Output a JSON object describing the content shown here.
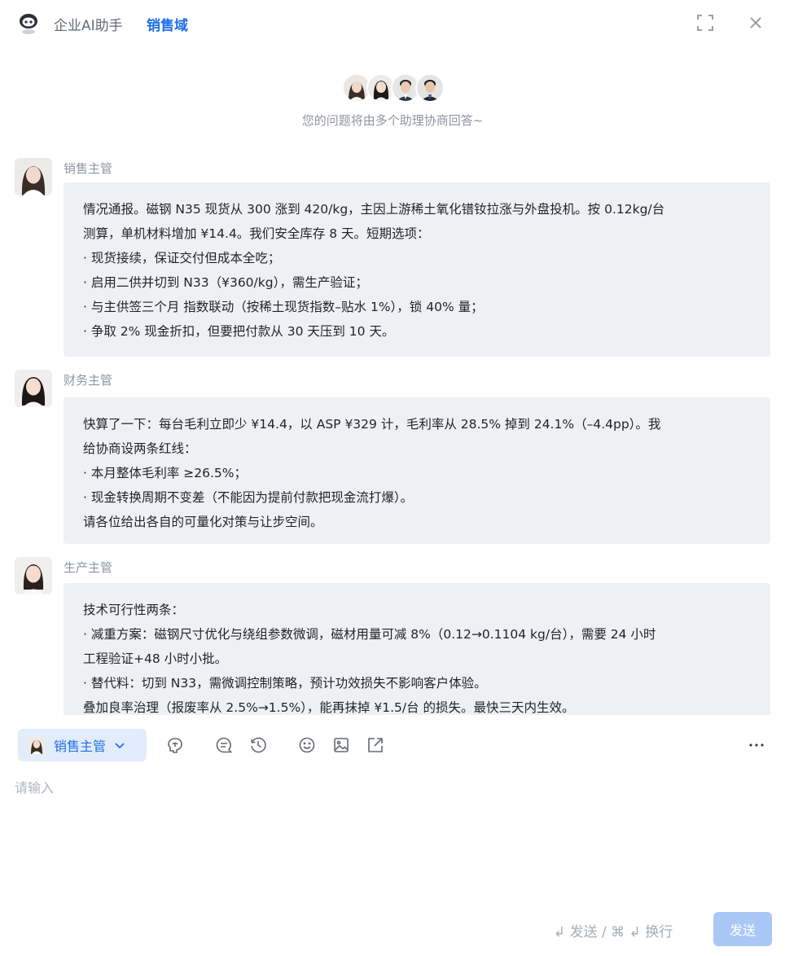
{
  "header": {
    "app_title": "企业AI助手",
    "domain_tab": "销售域",
    "logo_icon": "robot-icon",
    "expand_icon": "fullscreen-icon",
    "close_icon": "close-icon"
  },
  "assistants": {
    "avatar_count": 4,
    "intro_text": "您的问题将由多个助理协商回答~"
  },
  "messages": [
    {
      "sender": "销售主管",
      "lines": [
        "情况通报。磁钢 N35 现货从 300 涨到 420/kg，主因上游稀土氧化镨钕拉涨与外盘投机。按 0.12kg/台",
        "测算，单机材料增加 ¥14.4。我们安全库存 8 天。短期选项：",
        "· 现货接续，保证交付但成本全吃；",
        "· 启用二供并切到 N33（¥360/kg），需生产验证；",
        "· 与主供签三个月 指数联动（按稀土现货指数–贴水 1%），锁 40% 量；",
        "· 争取 2% 现金折扣，但要把付款从 30 天压到 10 天。"
      ]
    },
    {
      "sender": "财务主管",
      "lines": [
        "快算了一下：每台毛利立即少 ¥14.4，以 ASP ¥329 计，毛利率从 28.5% 掉到 24.1%（–4.4pp）。我",
        "给协商设两条红线：",
        "· 本月整体毛利率 ≥26.5%；",
        "· 现金转换周期不变差（不能因为提前付款把现金流打爆）。",
        "请各位给出各自的可量化对策与让步空间。"
      ]
    },
    {
      "sender": "生产主管",
      "lines": [
        "技术可行性两条：",
        "· 减重方案：磁钢尺寸优化与绕组参数微调，磁材用量可减 8%（0.12→0.1104 kg/台），需要 24 小时",
        "工程验证+48 小时小批。",
        "· 替代料：切到 N33，需微调控制策略，预计功效损失不影响客户体验。",
        "叠加良率治理（报废率从 2.5%→1.5%），能再抹掉 ¥1.5/台 的损失。最快三天内生效。"
      ]
    }
  ],
  "toolbar": {
    "selected_agent": "销售主管",
    "tools": [
      "brain-icon",
      "chat-bubble-icon",
      "history-icon",
      "emoji-icon",
      "image-icon",
      "share-icon",
      "more-icon"
    ]
  },
  "input": {
    "placeholder": "请输入",
    "value": ""
  },
  "footer": {
    "shortcut_hint": "↲ 发送 / ⌘ ↲ 换行",
    "send_label": "发送"
  },
  "colors": {
    "accent": "#1f6fe6",
    "bubble_bg": "#eef0f4",
    "send_disabled": "#a9c8f6",
    "muted_text": "#8f959e"
  }
}
